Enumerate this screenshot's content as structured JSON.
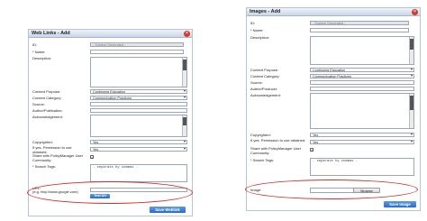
{
  "web_links": {
    "title": "Web Links - Add",
    "id_label": "ID:",
    "id_value": "- System Generated -",
    "name_label": "* Name:",
    "description_label": "Description:",
    "content_purpose_label": "Content Purpose:",
    "content_purpose_value": "Continuing Education",
    "content_category_label": "Content Category:",
    "content_category_value": "Communication Practices",
    "source_label": "Source:",
    "author_label": "Author/Publication:",
    "acknowledgement_label": "Acknowledgement:",
    "copyrighted_label": "Copyrighted:",
    "copyrighted_value": "Yes",
    "permission_label": "If yes, Permission to use obtained:",
    "permission_value": "Yes",
    "share_label": "Share with PolicyManager User Community:",
    "share_checked": "✓",
    "search_tags_label": "* Search Tags:",
    "search_tags_placeholder": "- separate by commas -",
    "url_label": "URL:",
    "url_example": "(e.g. http://www.google.com)",
    "test_url_button": "Test Url",
    "save_button": "Save Weblink"
  },
  "images": {
    "title": "Images - Add",
    "id_label": "ID:",
    "id_value": "- System Generated -",
    "name_label": "* Name:",
    "description_label": "Description:",
    "content_purpose_label": "Content Purpose:",
    "content_purpose_value": "Continuing Education",
    "content_category_label": "Content Category:",
    "content_category_value": "Communication Practices",
    "source_label": "Source:",
    "author_label": "Author/Producer:",
    "acknowledgement_label": "Acknowledgement:",
    "copyrighted_label": "Copyrighted:",
    "copyrighted_value": "Yes",
    "permission_label": "If yes, Permission to use obtained:",
    "permission_value": "Yes",
    "share_label": "Share with PolicyManager User Community:",
    "share_checked": "✓",
    "search_tags_label": "* Search Tags:",
    "search_tags_placeholder": "- separate by commas -",
    "image_label": "Image:",
    "browse_button": "Browse",
    "save_button": "Save Image"
  },
  "colors": {
    "accent": "#2b6cc4",
    "highlight_ellipse": "#d42c2c",
    "close_button": "#d9362b"
  }
}
